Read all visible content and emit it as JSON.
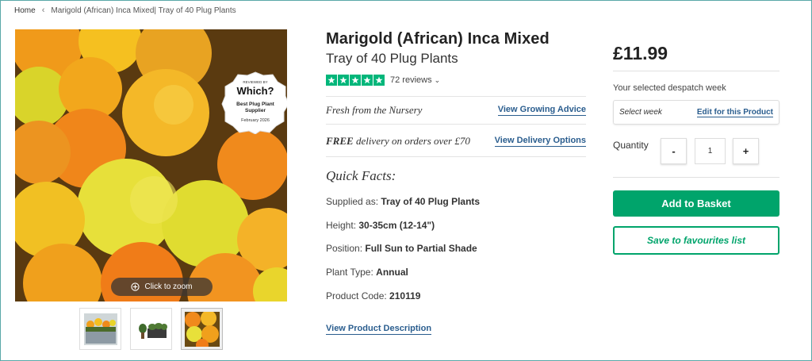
{
  "breadcrumb": {
    "home": "Home",
    "current": "Marigold (African) Inca Mixed| Tray of 40 Plug Plants"
  },
  "gallery": {
    "badge": {
      "top": "REVIEWED BY",
      "brand": "Which?",
      "line1": "Best Plug Plant",
      "line2": "Supplier",
      "date": "February 2026"
    },
    "zoom_label": "Click to zoom",
    "thumbnails": [
      "thumb-1",
      "thumb-2",
      "thumb-3"
    ],
    "active_thumbnail": 3
  },
  "product": {
    "title": "Marigold (African) Inca Mixed",
    "subtitle": "Tray of 40 Plug Plants",
    "rating_stars": 5,
    "reviews": "72 reviews",
    "nursery_text": "Fresh from the Nursery",
    "growing_link": "View Growing Advice",
    "delivery_free": "FREE",
    "delivery_text": " delivery on orders over £70",
    "delivery_link": "View Delivery Options",
    "quick_facts_title": "Quick Facts:",
    "facts": [
      {
        "label": "Supplied as: ",
        "value": "Tray of 40 Plug Plants"
      },
      {
        "label": "Height: ",
        "value": "30-35cm (12-14\")"
      },
      {
        "label": "Position: ",
        "value": "Full Sun to Partial Shade"
      },
      {
        "label": "Plant Type: ",
        "value": "Annual"
      },
      {
        "label": "Product Code: ",
        "value": "210119"
      }
    ],
    "description_link": "View Product Description"
  },
  "purchase": {
    "price": "£11.99",
    "despatch_label": "Your selected despatch week",
    "week_placeholder": "Select week",
    "week_edit": "Edit for this Product",
    "quantity_label": "Quantity",
    "minus": "-",
    "quantity": "1",
    "plus": "+",
    "basket_button": "Add to Basket",
    "favourites_button": "Save to favourites list"
  },
  "colors": {
    "green": "#00a46b",
    "trustpilot": "#00b67a",
    "link": "#2a5d8e"
  }
}
